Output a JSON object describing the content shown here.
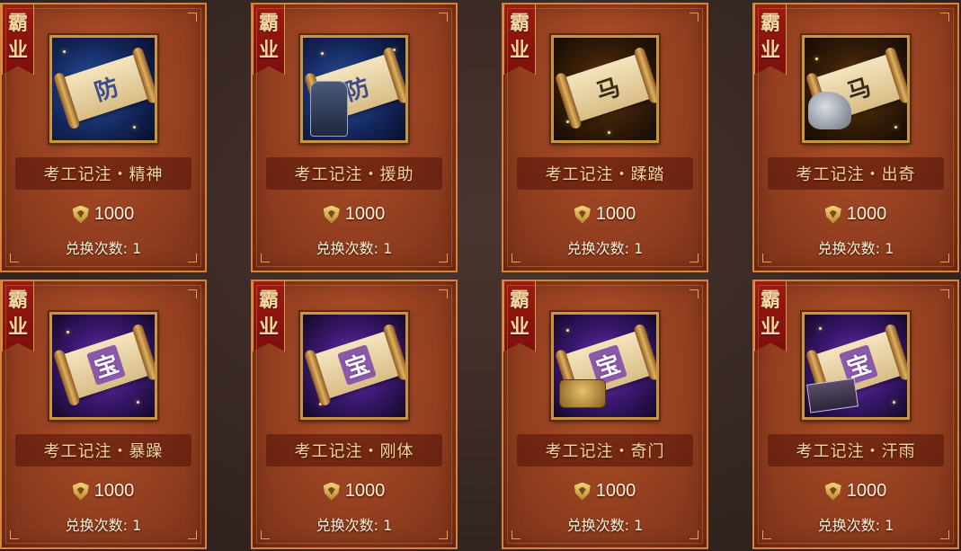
{
  "ribbon": {
    "line1": "霸",
    "line2": "业"
  },
  "labels": {
    "limit_prefix": "兑换次数:"
  },
  "cards": [
    {
      "name": "考工记注・精神",
      "price": "1000",
      "limit": "1",
      "scroll_glyph": "防",
      "bg": "blue",
      "extra_icon": "none"
    },
    {
      "name": "考工记注・援助",
      "price": "1000",
      "limit": "1",
      "scroll_glyph": "防",
      "bg": "blue",
      "extra_icon": "armor-icon"
    },
    {
      "name": "考工记注・蹂踏",
      "price": "1000",
      "limit": "1",
      "scroll_glyph": "马",
      "bg": "fire",
      "extra_icon": "none"
    },
    {
      "name": "考工记注・出奇",
      "price": "1000",
      "limit": "1",
      "scroll_glyph": "马",
      "bg": "fire",
      "extra_icon": "horse-icon"
    },
    {
      "name": "考工记注・暴躁",
      "price": "1000",
      "limit": "1",
      "scroll_glyph": "宝",
      "bg": "purple",
      "extra_icon": "none"
    },
    {
      "name": "考工记注・刚体",
      "price": "1000",
      "limit": "1",
      "scroll_glyph": "宝",
      "bg": "purple",
      "extra_icon": "none"
    },
    {
      "name": "考工记注・奇门",
      "price": "1000",
      "limit": "1",
      "scroll_glyph": "宝",
      "bg": "purple",
      "extra_icon": "coins-icon"
    },
    {
      "name": "考工记注・汗雨",
      "price": "1000",
      "limit": "1",
      "scroll_glyph": "宝",
      "bg": "purple",
      "extra_icon": "books-icon"
    }
  ]
}
